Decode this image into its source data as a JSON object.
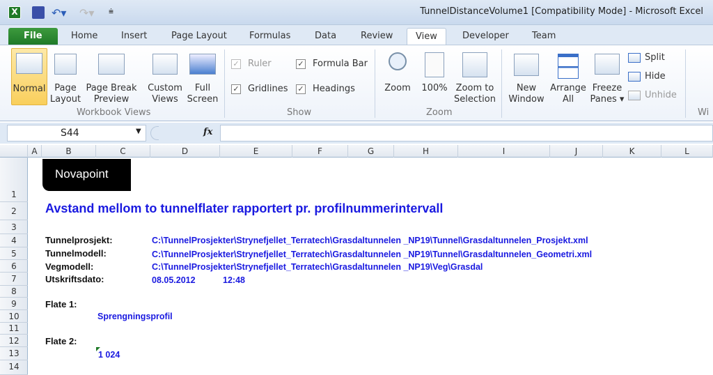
{
  "window": {
    "title": "TunnelDistanceVolume1  [Compatibility Mode]  -  Microsoft Excel"
  },
  "qat": {
    "icons": [
      "excel-logo-icon",
      "save-icon",
      "undo-icon",
      "redo-icon",
      "customize-qat-icon"
    ]
  },
  "tabs": [
    "File",
    "Home",
    "Insert",
    "Page Layout",
    "Formulas",
    "Data",
    "Review",
    "View",
    "Developer",
    "Team"
  ],
  "active_tab": "View",
  "ribbon": {
    "workbook_views": {
      "label": "Workbook Views",
      "buttons": [
        "Normal",
        "Page Layout",
        "Page Break Preview",
        "Custom Views",
        "Full Screen"
      ],
      "btn_lines": [
        [
          "Normal",
          ""
        ],
        [
          "Page",
          "Layout"
        ],
        [
          "Page Break",
          "Preview"
        ],
        [
          "Custom",
          "Views"
        ],
        [
          "Full",
          "Screen"
        ]
      ]
    },
    "show": {
      "label": "Show",
      "ruler": "Ruler",
      "formula_bar": "Formula Bar",
      "gridlines": "Gridlines",
      "headings": "Headings",
      "ruler_checked": true,
      "formula_bar_checked": true,
      "gridlines_checked": true,
      "headings_checked": true
    },
    "zoom": {
      "label": "Zoom",
      "btn_lines": [
        [
          "Zoom",
          ""
        ],
        [
          "100%",
          ""
        ],
        [
          "Zoom to",
          "Selection"
        ]
      ]
    },
    "window": {
      "label": "Wi",
      "btn_lines": [
        [
          "New",
          "Window"
        ],
        [
          "Arrange",
          "All"
        ],
        [
          "Freeze",
          "Panes ▾"
        ]
      ],
      "split": "Split",
      "hide": "Hide",
      "unhide": "Unhide"
    }
  },
  "formula_bar": {
    "name_box": "S44",
    "fx": "fx",
    "value": ""
  },
  "columns": [
    "A",
    "B",
    "C",
    "D",
    "E",
    "F",
    "G",
    "H",
    "I",
    "J",
    "K",
    "L"
  ],
  "rows": [
    "1",
    "2",
    "3",
    "4",
    "5",
    "6",
    "7",
    "8",
    "9",
    "10",
    "11",
    "12",
    "13",
    "14"
  ],
  "sheet": {
    "logo": "Novapoint",
    "heading": "Avstand mellom to tunnelflater rapportert pr. profilnummerintervall",
    "tunnelprosjekt_label": "Tunnelprosjekt:",
    "tunnelprosjekt": "C:\\TunnelProsjekter\\Strynefjellet_Terratech\\Grasdaltunnelen _NP19\\Tunnel\\Grasdaltunnelen_Prosjekt.xml",
    "tunnelmodell_label": "Tunnelmodell:",
    "tunnelmodell": "C:\\TunnelProsjekter\\Strynefjellet_Terratech\\Grasdaltunnelen _NP19\\Tunnel\\Grasdaltunnelen_Geometri.xml",
    "vegmodell_label": "Vegmodell:",
    "vegmodell": "C:\\TunnelProsjekter\\Strynefjellet_Terratech\\Grasdaltunnelen _NP19\\Veg\\Grasdal",
    "utskriftsdato_label": "Utskriftsdato:",
    "date": "08.05.2012",
    "time": "12:48",
    "flate1_label": "Flate 1:",
    "flate1": "Sprengningsprofil",
    "flate2_label": "Flate 2:",
    "flate2": "1 024"
  },
  "colors": {
    "value_text": "#1a1ae0",
    "heading": "#1a1ae0",
    "file_tab": "#2a8a30",
    "active_button": "#fbd974"
  }
}
